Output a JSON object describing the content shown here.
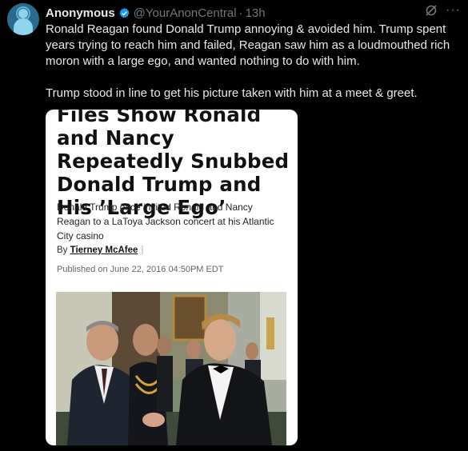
{
  "tweet": {
    "author_name": "Anonymous",
    "handle": "@YourAnonCentral",
    "separator": "·",
    "time": "13h",
    "paragraphs": [
      "Ronald Reagan found Donald Trump annoying & avoided him. Trump spent years trying to reach him and failed, Reagan saw him as a loudmouthed rich moron with a large ego, and wanted nothing to do with him.",
      "Trump stood in line to get his picture taken with him at a meet & greet."
    ],
    "more_glyph": "···"
  },
  "article": {
    "headline": "Files Show Ronald and Nancy Repeatedly Snubbed Donald Trump and His ’Large Ego’",
    "subhead": "Donald Trump once invited Ronald and Nancy Reagan to a LaToya Jackson concert at his Atlantic City casino",
    "by_label": "By",
    "author": "Tierney McAfee",
    "published": "Published on June 22, 2016 04:50PM EDT"
  },
  "icons": {
    "avatar": "anonymous-avatar",
    "verified": "verified-badge-icon",
    "grok": "grok-icon",
    "more": "more-icon"
  },
  "colors": {
    "background": "#000000",
    "text": "#e7e9ea",
    "secondary": "#71767b",
    "verified": "#1d9bf0"
  }
}
